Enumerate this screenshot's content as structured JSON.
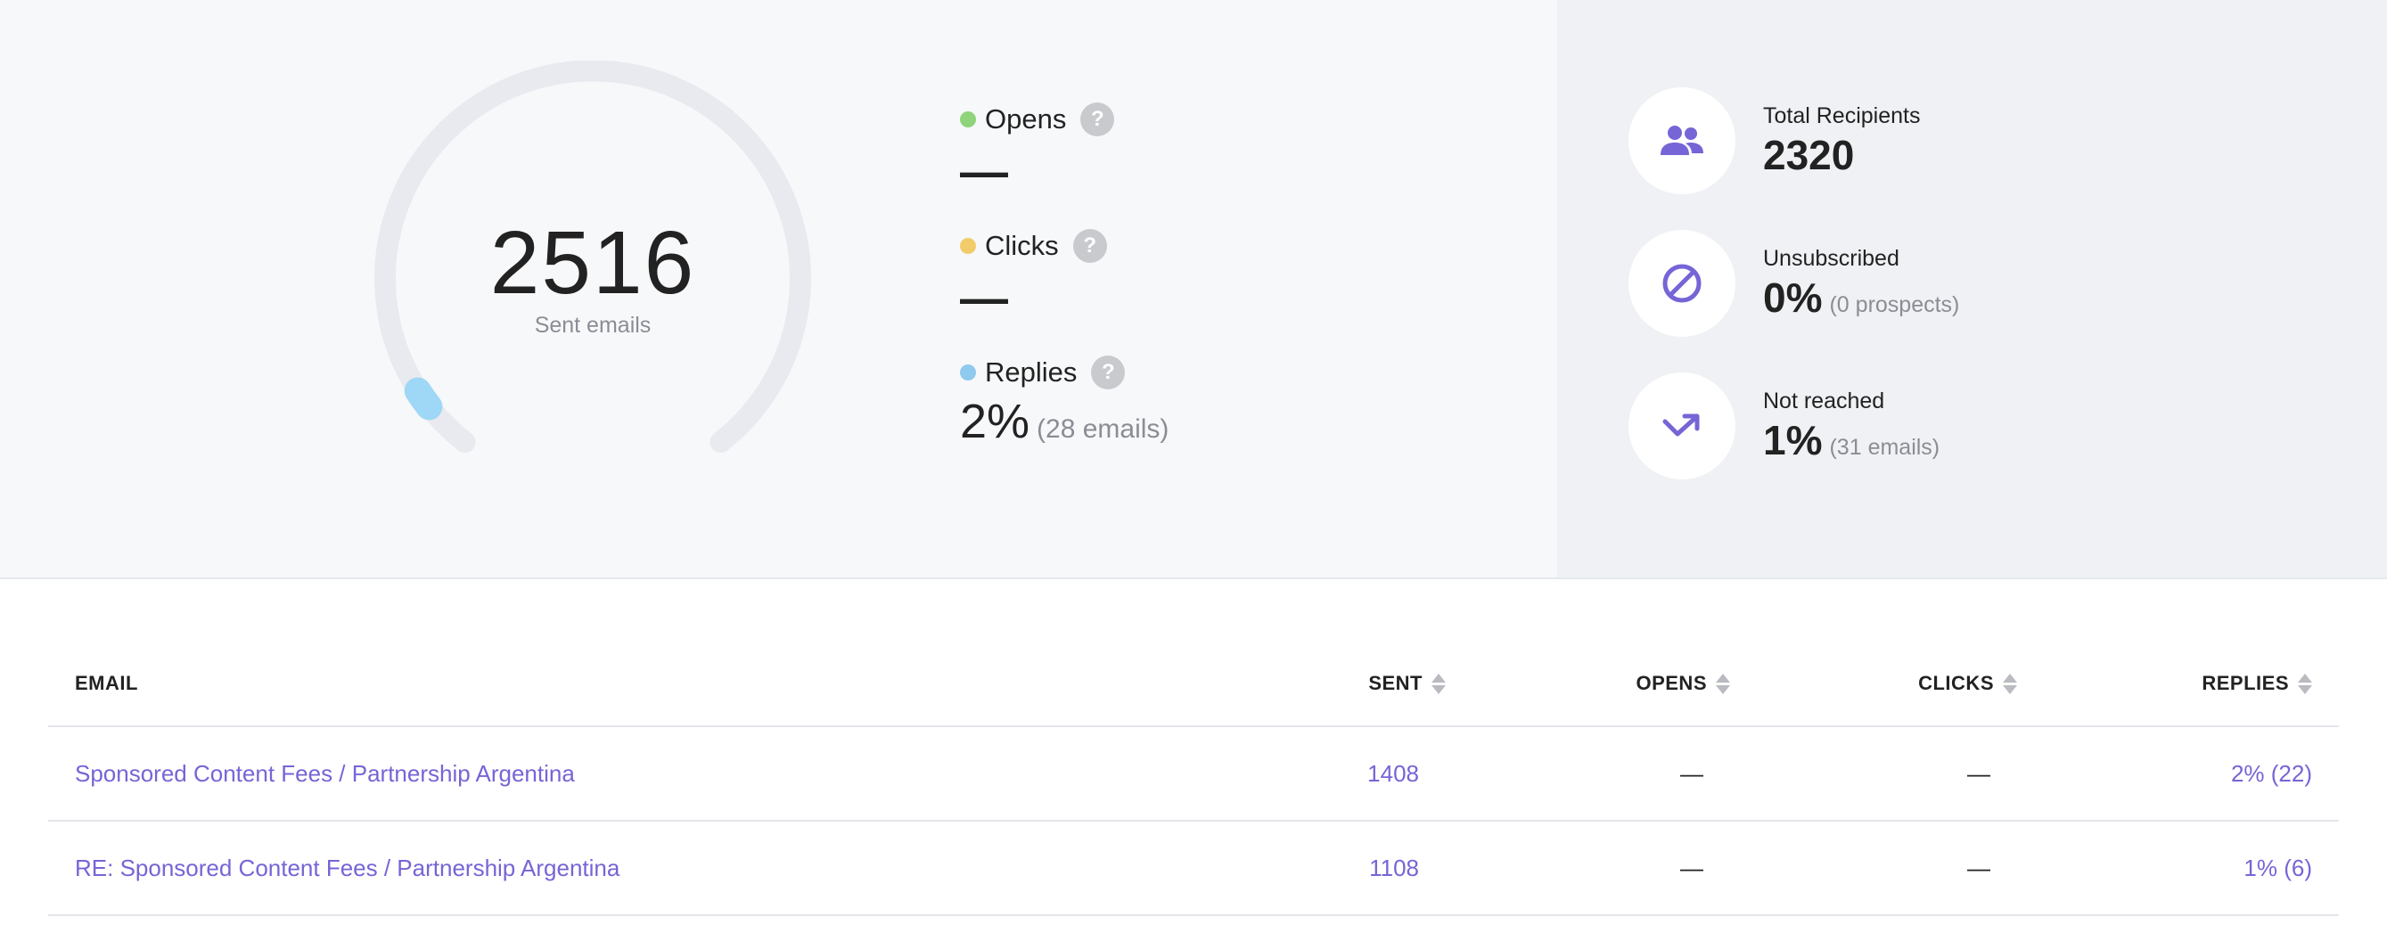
{
  "colors": {
    "accent": "#7565d6",
    "opens_dot": "#8fd47a",
    "clicks_dot": "#f2cc6b",
    "replies_dot": "#8ec9ee",
    "gauge_track": "#e9eaef",
    "gauge_fill": "#9fd7f6"
  },
  "gauge": {
    "number": "2516",
    "label": "Sent emails",
    "fill_fraction": 0.02
  },
  "metrics": [
    {
      "name": "Opens",
      "value": "—",
      "detail": "",
      "help": "?"
    },
    {
      "name": "Clicks",
      "value": "—",
      "detail": "",
      "help": "?"
    },
    {
      "name": "Replies",
      "value": "2%",
      "detail": "(28 emails)",
      "help": "?"
    }
  ],
  "stats": [
    {
      "icon": "people-icon",
      "label": "Total Recipients",
      "value": "2320",
      "detail": ""
    },
    {
      "icon": "block-icon",
      "label": "Unsubscribed",
      "value": "0%",
      "detail": "(0 prospects)"
    },
    {
      "icon": "trending-arrow-icon",
      "label": "Not reached",
      "value": "1%",
      "detail": "(31 emails)"
    }
  ],
  "table": {
    "columns": [
      "EMAIL",
      "SENT",
      "OPENS",
      "CLICKS",
      "REPLIES"
    ],
    "rows": [
      {
        "email": "Sponsored Content Fees / Partnership Argentina",
        "sent": "1408",
        "opens": "—",
        "clicks": "—",
        "replies": "2% (22)"
      },
      {
        "email": "RE: Sponsored Content Fees / Partnership Argentina",
        "sent": "1108",
        "opens": "—",
        "clicks": "—",
        "replies": "1% (6)"
      }
    ]
  }
}
